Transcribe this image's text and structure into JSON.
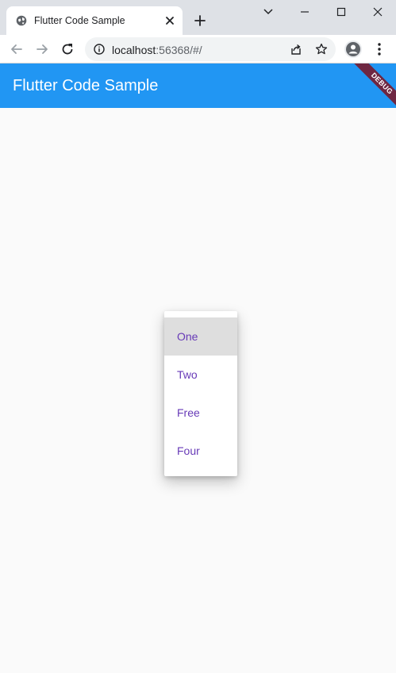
{
  "browser": {
    "tab_title": "Flutter Code Sample",
    "url_host": "localhost",
    "url_rest": ":56368/#/"
  },
  "app": {
    "title": "Flutter Code Sample",
    "debug_banner": "DEBUG",
    "appbar_color": "#2196f3",
    "accent_color": "#673ab7"
  },
  "popup_menu": {
    "items": [
      {
        "label": "One",
        "highlighted": true
      },
      {
        "label": "Two",
        "highlighted": false
      },
      {
        "label": "Free",
        "highlighted": false
      },
      {
        "label": "Four",
        "highlighted": false
      }
    ]
  }
}
